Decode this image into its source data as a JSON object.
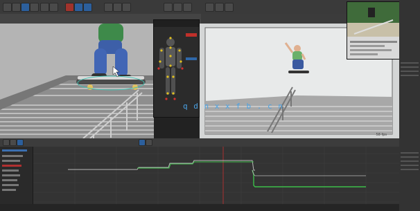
{
  "watermark": "q d n x x f b . c n",
  "viewport_right": {
    "fps_label": "58 fps"
  },
  "colors": {
    "toolbar_bg": "#3a3a3a",
    "left_viewport_bg": "#b4b4b4",
    "right_viewport_bg": "#cfd2d2",
    "timeline_bg": "#2d2d2d",
    "curve_light": "#b9b9b9",
    "curve_green": "#3cbf4a",
    "curve_red": "#d03030",
    "accent_blue": "#2f67a8",
    "accent_red": "#c0302a",
    "watermark": "#4aa3e6"
  },
  "icons": {
    "toolbar": [
      "select-icon",
      "move-icon",
      "rotate-icon",
      "scale-icon",
      "snap-icon",
      "render-icon",
      "camera-icon",
      "play-icon"
    ],
    "timeline": [
      "play-icon",
      "key-icon",
      "graph-icon"
    ]
  }
}
